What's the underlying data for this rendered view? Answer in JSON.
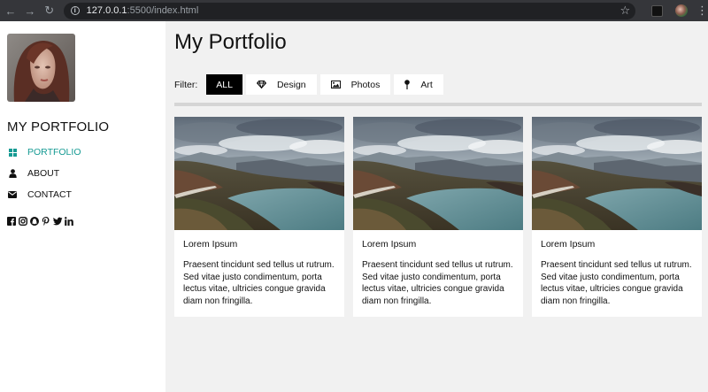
{
  "browser": {
    "url_host": "127.0.0.1",
    "url_rest": ":5500/index.html"
  },
  "sidebar": {
    "brand": "MY PORTFOLIO",
    "items": [
      {
        "label": "PORTFOLIO",
        "icon": "grid-icon",
        "active": true
      },
      {
        "label": "ABOUT",
        "icon": "user-icon",
        "active": false
      },
      {
        "label": "CONTACT",
        "icon": "envelope-icon",
        "active": false
      }
    ],
    "social_icons": [
      "facebook-icon",
      "instagram-icon",
      "snapchat-icon",
      "pinterest-icon",
      "twitter-icon",
      "linkedin-icon"
    ]
  },
  "main": {
    "title": "My Portfolio",
    "filter_label": "Filter:",
    "filters": [
      {
        "label": "ALL",
        "active": true
      },
      {
        "label": "Design",
        "icon": "diamond-icon"
      },
      {
        "label": "Photos",
        "icon": "image-icon"
      },
      {
        "label": "Art",
        "icon": "pushpin-icon"
      }
    ],
    "cards": [
      {
        "title": "Lorem Ipsum",
        "text": "Praesent tincidunt sed tellus ut rutrum. Sed vitae justo condimentum, porta lectus vitae, ultricies congue gravida diam non fringilla."
      },
      {
        "title": "Lorem Ipsum",
        "text": "Praesent tincidunt sed tellus ut rutrum. Sed vitae justo condimentum, porta lectus vitae, ultricies congue gravida diam non fringilla."
      },
      {
        "title": "Lorem Ipsum",
        "text": "Praesent tincidunt sed tellus ut rutrum. Sed vitae justo condimentum, porta lectus vitae, ultricies congue gravida diam non fringilla."
      }
    ]
  },
  "colors": {
    "accent": "#159a93",
    "active_filter_bg": "#000000",
    "page_bg": "#f1f1f1"
  }
}
